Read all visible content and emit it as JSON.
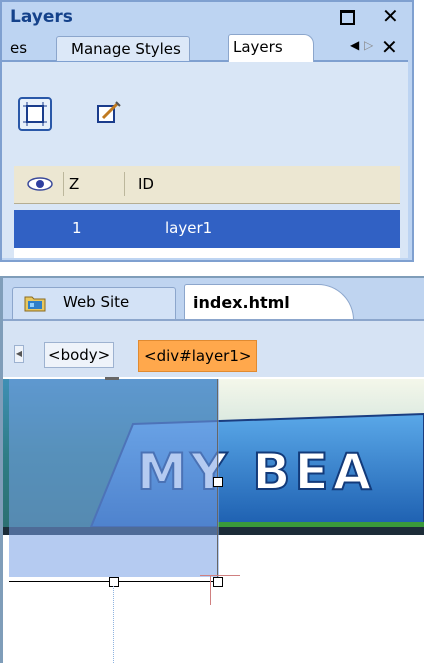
{
  "layers_panel": {
    "title": "Layers",
    "tabs": {
      "partial": "es",
      "manage_styles": "Manage Styles",
      "layers": "Layers"
    },
    "grid": {
      "headers": {
        "z": "Z",
        "id": "ID"
      },
      "rows": [
        {
          "z": "1",
          "id": "layer1",
          "selected": true
        }
      ]
    }
  },
  "document": {
    "tabs": {
      "website": "Web Site",
      "file": "index.html"
    },
    "breadcrumbs": [
      "<body>",
      "<div#layer1>"
    ],
    "banner_text": "MY BEA"
  },
  "colors": {
    "panel_bg": "#bdd4f2",
    "selected_row": "#3161c4",
    "active_crumb": "#ffa84c",
    "layer_overlay": "#78a0e6"
  },
  "icons": [
    "maximize-icon",
    "close-icon",
    "tab-scroll-left-icon",
    "tab-scroll-right-icon",
    "draw-layer-icon",
    "edit-layer-icon",
    "eye-icon",
    "folder-icon"
  ]
}
